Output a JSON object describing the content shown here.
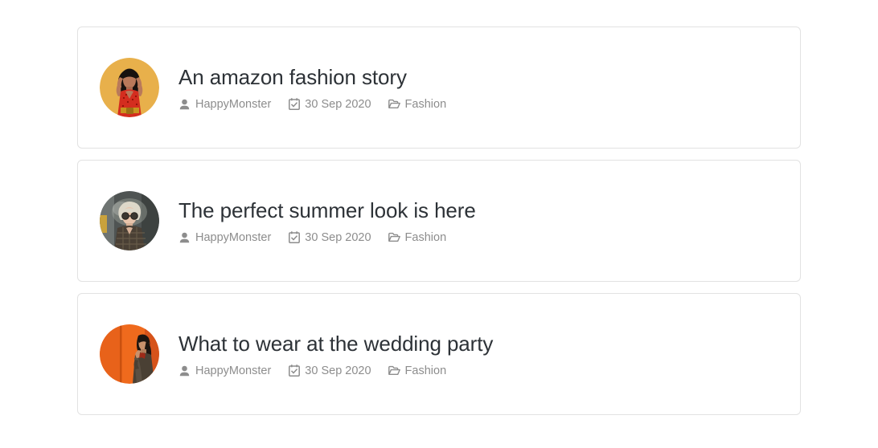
{
  "page": {
    "background_color": "#ffffff",
    "card_border_color": "#e2e2e2",
    "title_color": "#2d3237",
    "meta_color": "#8d8d8d"
  },
  "post_list": {
    "posts": [
      {
        "title": "An amazon fashion story",
        "author": "HappyMonster",
        "date": "30 Sep 2020",
        "category": "Fashion",
        "avatar": {
          "name": "woman-in-red-dress-on-yellow-background",
          "background_color": "#e8b04b",
          "accent_color": "#d42d1f"
        }
      },
      {
        "title": "The perfect summer look is here",
        "author": "HappyMonster",
        "date": "30 Sep 2020",
        "category": "Fashion",
        "avatar": {
          "name": "person-with-white-hair-and-sunglasses",
          "background_color": "#4a4f50",
          "accent_color": "#d9d4c8"
        }
      },
      {
        "title": "What to wear at the wedding party",
        "author": "HappyMonster",
        "date": "30 Sep 2020",
        "category": "Fashion",
        "avatar": {
          "name": "person-against-orange-wall",
          "background_color": "#f06a1e",
          "accent_color": "#3a2b22"
        }
      }
    ],
    "icons": {
      "author": "user-icon",
      "date": "calendar-check-icon",
      "category": "folder-open-icon"
    }
  }
}
